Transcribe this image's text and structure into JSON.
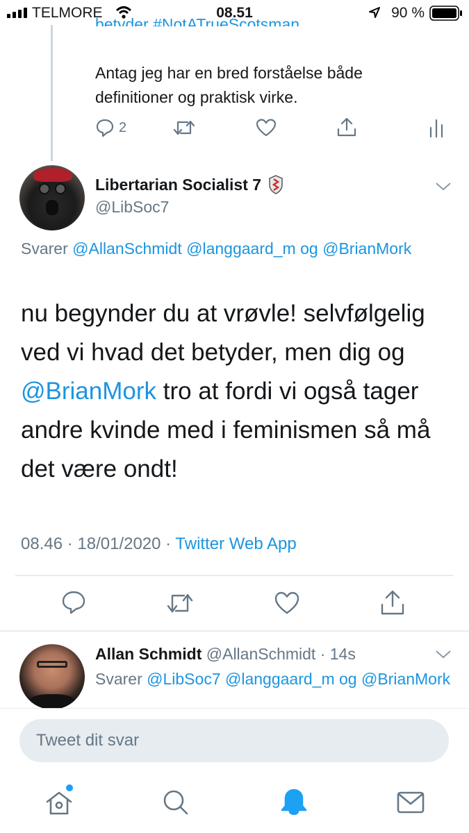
{
  "status_bar": {
    "carrier": "TELMORE",
    "time": "08.51",
    "battery": "90 %"
  },
  "previous_tweet": {
    "cut_line": "betyder #NotATrueScotsman",
    "text_lines": [
      "Antag jeg har en bred forståelse både",
      "definitioner og praktisk virke."
    ],
    "reply_count": "2"
  },
  "main_tweet": {
    "name": "Libertarian Socialist 7",
    "handle": "@LibSoc7",
    "replying_prefix": "Svarer",
    "replying_mentions": [
      "@AllanSchmidt",
      "@langgaard_m",
      "og",
      "@BrianMork"
    ],
    "text_part1": "nu begynder du at vrøvle! selvfølgelig ved vi hvad det betyder, men dig og",
    "text_mention": "@BrianMork",
    "text_part2": "tro at fordi vi også tager andre kvinde med i feminismen så må det være ondt!",
    "timestamp": "08.46 · 18/01/2020 ·",
    "source": "Twitter Web App"
  },
  "reply_tweet": {
    "name": "Allan Schmidt",
    "handle": "@AllanSchmidt",
    "time": "· 14s",
    "replying_prefix": "Svarer",
    "replying_mentions": [
      "@LibSoc7",
      "@langgaard_m",
      "og",
      "@BrianMork"
    ]
  },
  "composer": {
    "placeholder": "Tweet dit svar"
  },
  "colors": {
    "link": "#1b95e0",
    "secondary": "#657786",
    "active_tab": "#1da1f2"
  }
}
